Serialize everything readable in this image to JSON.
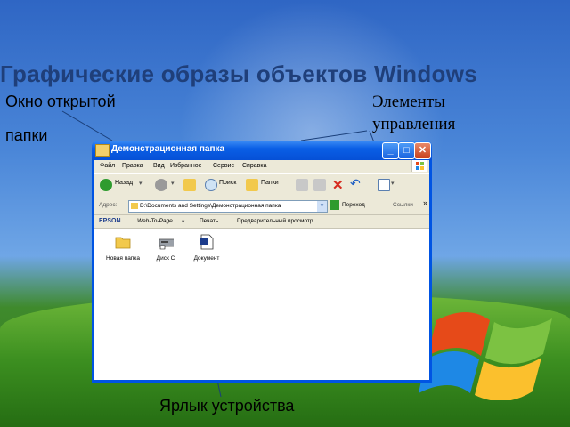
{
  "slide": {
    "title": "Графические образы объектов Windows",
    "callout_window_line1": "Окно открытой",
    "callout_window_line2": "папки",
    "callout_controls_line1": "Элементы",
    "callout_controls_line2": "управления",
    "callout_device": "Ярлык устройства"
  },
  "window": {
    "title": "Демонстрационная папка",
    "buttons": [
      "_",
      "□",
      "✕"
    ],
    "menu": [
      "Файл",
      "Правка",
      "Вид",
      "Избранное",
      "Сервис",
      "Справка"
    ],
    "toolbar": {
      "back": "Назад",
      "search": "Поиск",
      "folders": "Папки"
    },
    "address": {
      "label": "Адрес:",
      "value": "D:\\Documents and Settings\\Демонстрационная папка",
      "go": "Переход",
      "links": "Ссылки"
    },
    "epson": {
      "brand": "EPSON",
      "web": "Web-To-Page",
      "print": "Печать",
      "preview": "Предварительный просмотр"
    },
    "items": [
      {
        "name": "Новая папка",
        "icon": "folder-icon"
      },
      {
        "name": "Диск C",
        "icon": "drive-shortcut-icon"
      },
      {
        "name": "Документ",
        "icon": "document-icon"
      }
    ]
  },
  "colors": {
    "title": "#1f3f7a",
    "titlebar": "#0a5fe6",
    "chrome": "#ece9d8"
  }
}
